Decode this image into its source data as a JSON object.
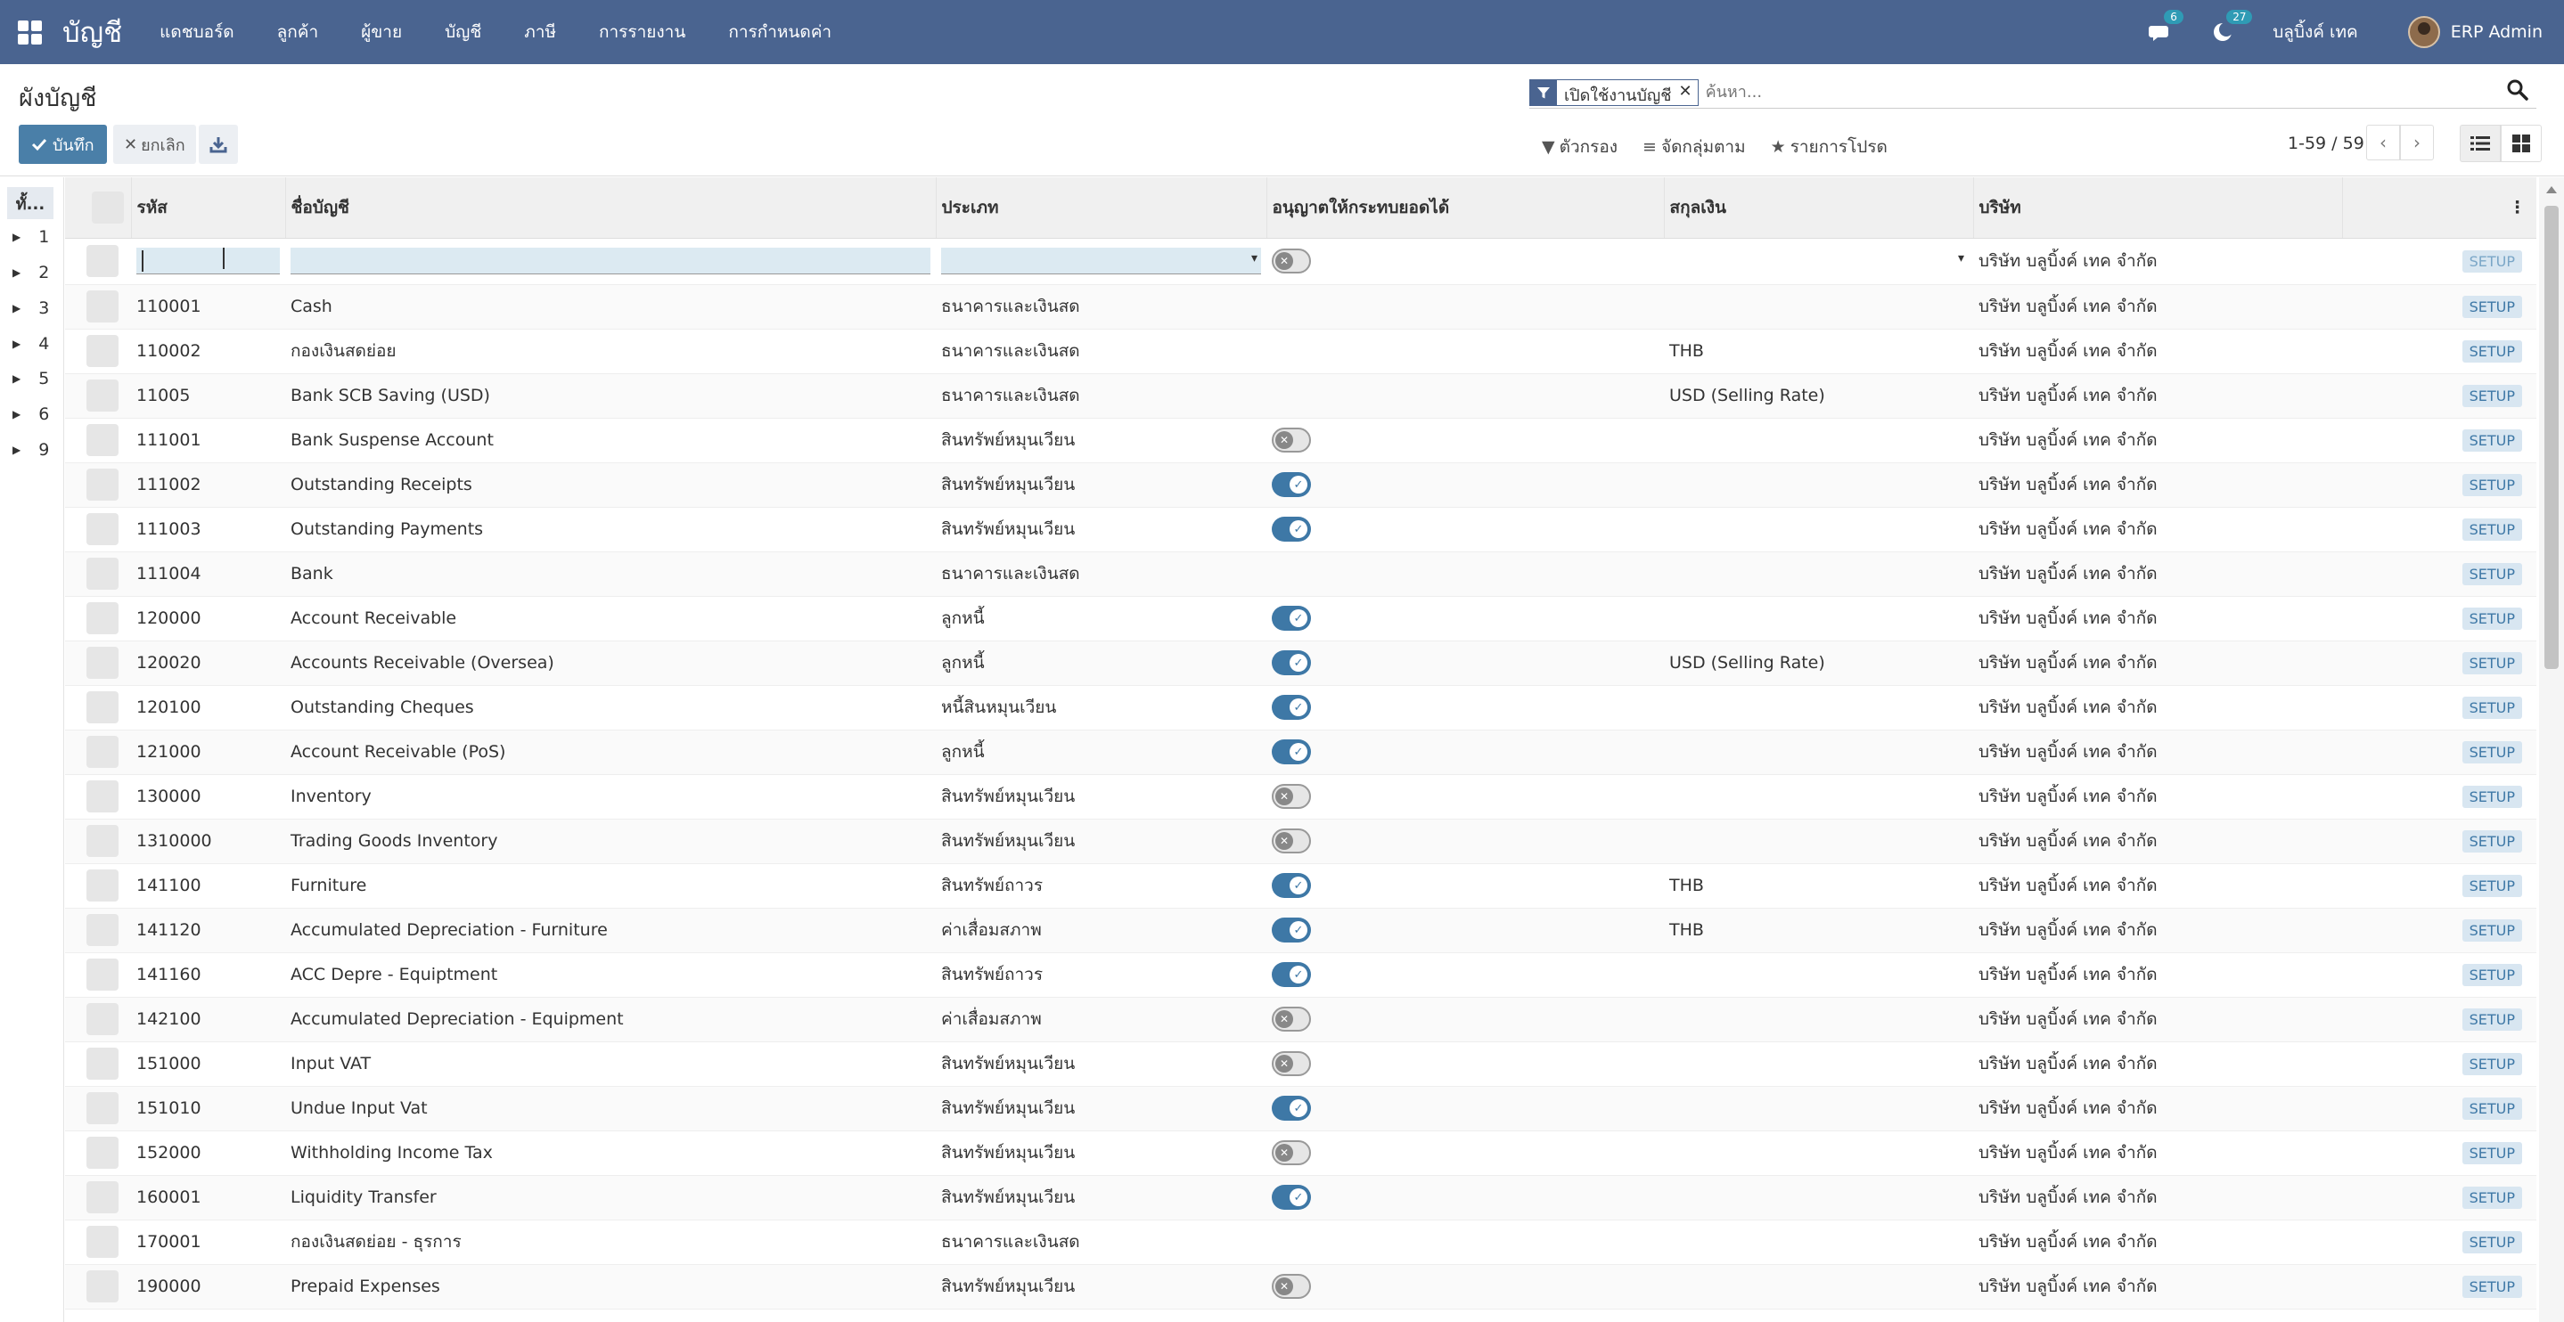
{
  "navbar": {
    "app_name": "บัญชี",
    "menu": [
      "แดชบอร์ด",
      "ลูกค้า",
      "ผู้ขาย",
      "บัญชี",
      "ภาษี",
      "การรายงาน",
      "การกำหนดค่า"
    ],
    "messages_count": "6",
    "activities_count": "27",
    "company": "บลูบิ้งค์ เทค",
    "user": "ERP Admin"
  },
  "control_panel": {
    "title": "ผังบัญชี",
    "save_label": "บันทึก",
    "discard_label": "ยกเลิก",
    "facet_value": "เปิดใช้งานบัญชี",
    "search_placeholder": "ค้นหา...",
    "filters_label": "ตัวกรอง",
    "groupby_label": "จัดกลุ่มตาม",
    "favorites_label": "รายการโปรด",
    "pager_value": "1-59 / 59"
  },
  "side_panel": {
    "all_label": "ทั้...",
    "groups": [
      "1",
      "2",
      "3",
      "4",
      "5",
      "6",
      "9"
    ]
  },
  "table": {
    "columns": [
      "รหัส",
      "ชื่อบัญชี",
      "ประเภท",
      "อนุญาตให้กระทบยอดได้",
      "สกุลเงิน",
      "บริษัท"
    ],
    "setup_label": "SETUP",
    "company_value": "บริษัท บลูบิ้งค์ เทค จำกัด",
    "rows": [
      {
        "code": "110001",
        "name": "Cash",
        "type": "ธนาคารและเงินสด",
        "reconcile": null,
        "currency": ""
      },
      {
        "code": "110002",
        "name": "กองเงินสดย่อย",
        "type": "ธนาคารและเงินสด",
        "reconcile": null,
        "currency": "THB"
      },
      {
        "code": "11005",
        "name": "Bank SCB Saving (USD)",
        "type": "ธนาคารและเงินสด",
        "reconcile": null,
        "currency": "USD (Selling Rate)"
      },
      {
        "code": "111001",
        "name": "Bank Suspense Account",
        "type": "สินทรัพย์หมุนเวียน",
        "reconcile": false,
        "currency": ""
      },
      {
        "code": "111002",
        "name": "Outstanding Receipts",
        "type": "สินทรัพย์หมุนเวียน",
        "reconcile": true,
        "currency": ""
      },
      {
        "code": "111003",
        "name": "Outstanding Payments",
        "type": "สินทรัพย์หมุนเวียน",
        "reconcile": true,
        "currency": ""
      },
      {
        "code": "111004",
        "name": "Bank",
        "type": "ธนาคารและเงินสด",
        "reconcile": null,
        "currency": ""
      },
      {
        "code": "120000",
        "name": "Account Receivable",
        "type": "ลูกหนี้",
        "reconcile": true,
        "currency": ""
      },
      {
        "code": "120020",
        "name": "Accounts Receivable (Oversea)",
        "type": "ลูกหนี้",
        "reconcile": true,
        "currency": "USD (Selling Rate)"
      },
      {
        "code": "120100",
        "name": "Outstanding Cheques",
        "type": "หนี้สินหมุนเวียน",
        "reconcile": true,
        "currency": ""
      },
      {
        "code": "121000",
        "name": "Account Receivable (PoS)",
        "type": "ลูกหนี้",
        "reconcile": true,
        "currency": ""
      },
      {
        "code": "130000",
        "name": "Inventory",
        "type": "สินทรัพย์หมุนเวียน",
        "reconcile": false,
        "currency": ""
      },
      {
        "code": "1310000",
        "name": "Trading Goods Inventory",
        "type": "สินทรัพย์หมุนเวียน",
        "reconcile": false,
        "currency": ""
      },
      {
        "code": "141100",
        "name": "Furniture",
        "type": "สินทรัพย์ถาวร",
        "reconcile": true,
        "currency": "THB"
      },
      {
        "code": "141120",
        "name": "Accumulated Depreciation - Furniture",
        "type": "ค่าเสื่อมสภาพ",
        "reconcile": true,
        "currency": "THB"
      },
      {
        "code": "141160",
        "name": "ACC Depre - Equiptment",
        "type": "สินทรัพย์ถาวร",
        "reconcile": true,
        "currency": ""
      },
      {
        "code": "142100",
        "name": "Accumulated Depreciation - Equipment",
        "type": "ค่าเสื่อมสภาพ",
        "reconcile": false,
        "currency": ""
      },
      {
        "code": "151000",
        "name": "Input VAT",
        "type": "สินทรัพย์หมุนเวียน",
        "reconcile": false,
        "currency": ""
      },
      {
        "code": "151010",
        "name": "Undue Input Vat",
        "type": "สินทรัพย์หมุนเวียน",
        "reconcile": true,
        "currency": ""
      },
      {
        "code": "152000",
        "name": "Withholding Income Tax",
        "type": "สินทรัพย์หมุนเวียน",
        "reconcile": false,
        "currency": ""
      },
      {
        "code": "160001",
        "name": "Liquidity Transfer",
        "type": "สินทรัพย์หมุนเวียน",
        "reconcile": true,
        "currency": ""
      },
      {
        "code": "170001",
        "name": "กองเงินสดย่อย - ธุรการ",
        "type": "ธนาคารและเงินสด",
        "reconcile": null,
        "currency": ""
      },
      {
        "code": "190000",
        "name": "Prepaid Expenses",
        "type": "สินทรัพย์หมุนเวียน",
        "reconcile": false,
        "currency": ""
      }
    ]
  },
  "colors": {
    "navbar": "#4a6490",
    "primary": "#4a7fa8",
    "toggle_on": "#3e78a6",
    "setup_bg": "#d8e6f1"
  }
}
